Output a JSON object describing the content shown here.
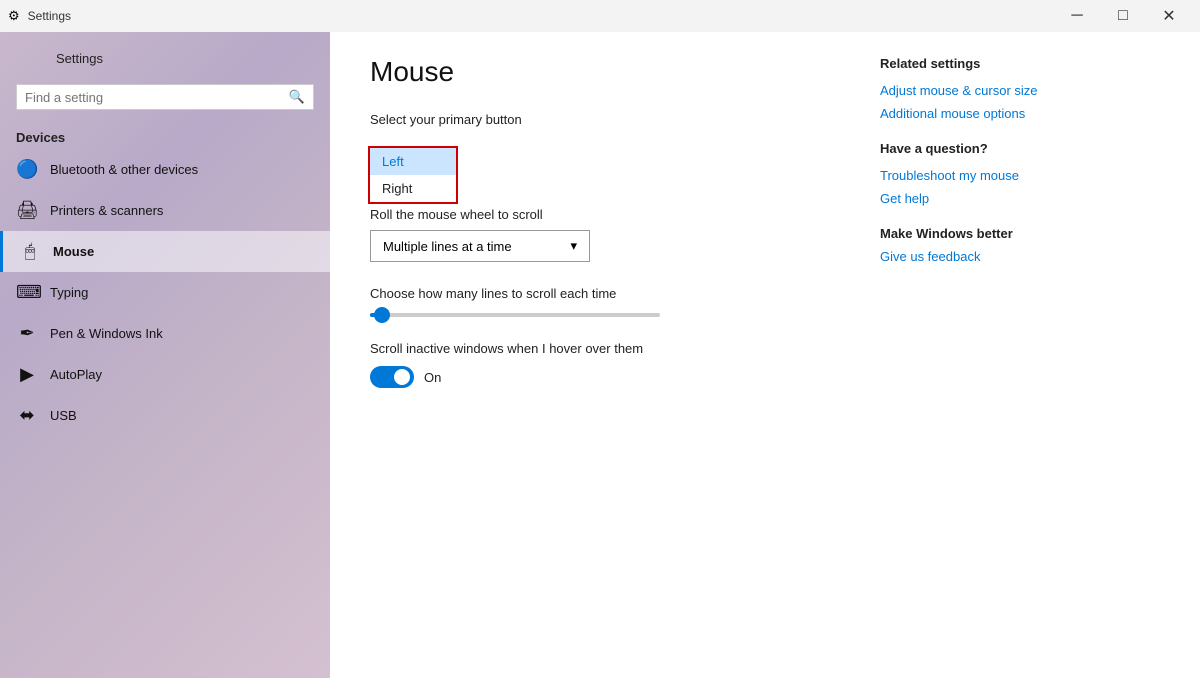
{
  "titleBar": {
    "title": "Settings",
    "minimizeLabel": "─",
    "maximizeLabel": "□",
    "closeLabel": "✕"
  },
  "sidebar": {
    "searchPlaceholder": "Find a setting",
    "backLabel": "←",
    "appTitle": "Settings",
    "sectionTitle": "Devices",
    "items": [
      {
        "id": "bluetooth",
        "label": "Bluetooth & other devices",
        "icon": "⬡"
      },
      {
        "id": "printers",
        "label": "Printers & scanners",
        "icon": "🖨"
      },
      {
        "id": "mouse",
        "label": "Mouse",
        "icon": "🖱",
        "active": true
      },
      {
        "id": "typing",
        "label": "Typing",
        "icon": "⌨"
      },
      {
        "id": "pen",
        "label": "Pen & Windows Ink",
        "icon": "✒"
      },
      {
        "id": "autoplay",
        "label": "AutoPlay",
        "icon": "▶"
      },
      {
        "id": "usb",
        "label": "USB",
        "icon": "⬌"
      }
    ]
  },
  "mainContent": {
    "pageTitle": "Mouse",
    "primaryButton": {
      "label": "Select your primary button",
      "options": [
        "Left",
        "Right"
      ],
      "selectedOption": "Left"
    },
    "scrollWheel": {
      "label": "Roll the mouse wheel to scroll",
      "selectedOption": "Multiple lines at a time",
      "chevron": "▾"
    },
    "scrollLines": {
      "label": "Choose how many lines to scroll each time"
    },
    "scrollInactive": {
      "label": "Scroll inactive windows when I hover over them",
      "toggleState": "On"
    }
  },
  "rightPanel": {
    "relatedSettings": {
      "title": "Related settings",
      "links": [
        "Adjust mouse & cursor size",
        "Additional mouse options"
      ]
    },
    "haveAQuestion": {
      "title": "Have a question?",
      "links": [
        "Troubleshoot my mouse",
        "Get help"
      ]
    },
    "makeWindowsBetter": {
      "title": "Make Windows better",
      "links": [
        "Give us feedback"
      ]
    }
  }
}
